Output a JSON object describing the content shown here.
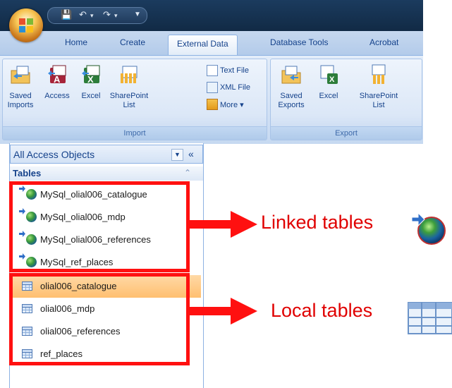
{
  "ribbon": {
    "tabs": [
      {
        "label": "Home",
        "active": false
      },
      {
        "label": "Create",
        "active": false
      },
      {
        "label": "External Data",
        "active": true
      },
      {
        "label": "Database Tools",
        "active": false
      },
      {
        "label": "Acrobat",
        "active": false
      }
    ],
    "import_group": {
      "label": "Import",
      "saved_imports_line1": "Saved",
      "saved_imports_line2": "Imports",
      "access": "Access",
      "excel": "Excel",
      "sharepoint_line1": "SharePoint",
      "sharepoint_line2": "List",
      "text_file": "Text File",
      "xml_file": "XML File",
      "more": "More ▾"
    },
    "export_group": {
      "label": "Export",
      "saved_exports_line1": "Saved",
      "saved_exports_line2": "Exports",
      "excel": "Excel",
      "sharepoint_line1": "SharePoint",
      "sharepoint_line2": "List"
    }
  },
  "nav": {
    "header": "All Access Objects",
    "section": "Tables",
    "linked_tables": [
      "MySql_olial006_catalogue",
      "MySql_olial006_mdp",
      "MySql_olial006_references",
      "MySql_ref_places"
    ],
    "local_tables": [
      "olial006_catalogue",
      "olial006_mdp",
      "olial006_references",
      "ref_places"
    ],
    "selected": "olial006_catalogue"
  },
  "annotations": {
    "linked_label": "Linked tables",
    "local_label": "Local tables",
    "color": "#ff1010"
  },
  "colors": {
    "ribbon_bg": "#d5e3f6",
    "selected_row": "#ffc67e",
    "titlebar": "#1b3b5e"
  }
}
